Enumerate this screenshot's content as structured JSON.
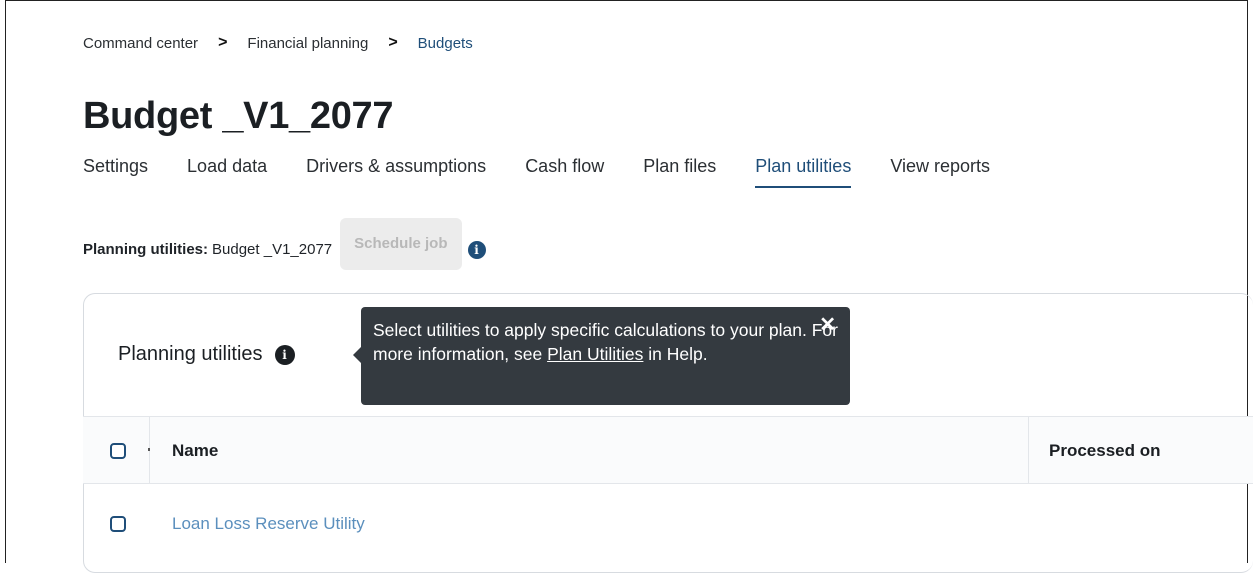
{
  "breadcrumb": {
    "items": [
      "Command center",
      "Financial planning",
      "Budgets"
    ],
    "separator": ">"
  },
  "page_title": "Budget _V1_2077",
  "tabs": [
    {
      "label": "Settings"
    },
    {
      "label": "Load data"
    },
    {
      "label": "Drivers & assumptions"
    },
    {
      "label": "Cash flow"
    },
    {
      "label": "Plan files"
    },
    {
      "label": "Plan utilities",
      "active": true
    },
    {
      "label": "View reports"
    }
  ],
  "planning_line": {
    "label": "Planning utilities:",
    "value": "Budget _V1_2077",
    "schedule_button": "Schedule job",
    "info_icon": "info-icon"
  },
  "card": {
    "title": "Planning utilities",
    "info_icon": "info-icon"
  },
  "tooltip": {
    "text_before": "Select utilities to apply specific calculations to your plan. For more information, see ",
    "link": "Plan Utilities",
    "text_after": " in Help.",
    "close_icon": "close-icon"
  },
  "table": {
    "columns": [
      "Name",
      "Processed on"
    ],
    "rows": [
      {
        "name": "Loan Loss Reserve Utility"
      }
    ]
  },
  "colors": {
    "accent": "#1f4e79",
    "row_link": "#5b8fbd",
    "tooltip_bg": "#343a40"
  }
}
